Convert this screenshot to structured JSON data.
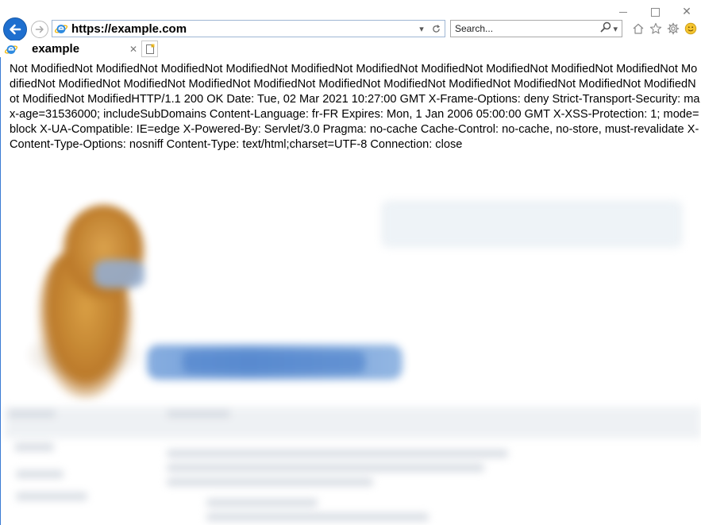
{
  "window": {
    "address": "https://example.com",
    "tab_title": "example",
    "search_placeholder": "Search..."
  },
  "page": {
    "response_text": "Not ModifiedNot ModifiedNot ModifiedNot ModifiedNot ModifiedNot ModifiedNot ModifiedNot ModifiedNot ModifiedNot ModifiedNot ModifiedNot ModifiedNot ModifiedNot ModifiedNot ModifiedNot ModifiedNot ModifiedNot ModifiedNot ModifiedNot ModifiedNot ModifiedNot ModifiedNot ModifiedHTTP/1.1 200 OK Date: Tue, 02 Mar 2021 10:27:00 GMT X-Frame-Options: deny Strict-Transport-Security: max-age=31536000; includeSubDomains Content-Language: fr-FR Expires: Mon, 1 Jan 2006 05:00:00 GMT X-XSS-Protection: 1; mode=block X-UA-Compatible: IE=edge X-Powered-By: Servlet/3.0 Pragma: no-cache Cache-Control: no-cache, no-store, must-revalidate X-Content-Type-Options: nosniff Content-Type: text/html;charset=UTF-8 Connection: close"
  },
  "icons": {
    "minimize": "minimize-icon",
    "maximize": "maximize-icon",
    "close": "close-icon",
    "back": "back-arrow-icon",
    "forward": "forward-arrow-icon",
    "site": "internet-explorer-icon",
    "dropdown": "chevron-down-icon",
    "refresh": "refresh-icon",
    "search": "search-icon",
    "home": "home-icon",
    "favorites": "star-icon",
    "tools": "gear-icon",
    "feedback": "smiley-icon",
    "tab_close": "close-icon",
    "new_tab": "new-tab-icon"
  },
  "colors": {
    "accent": "#1e6fcf",
    "frame_border": "#3b7bd4"
  }
}
